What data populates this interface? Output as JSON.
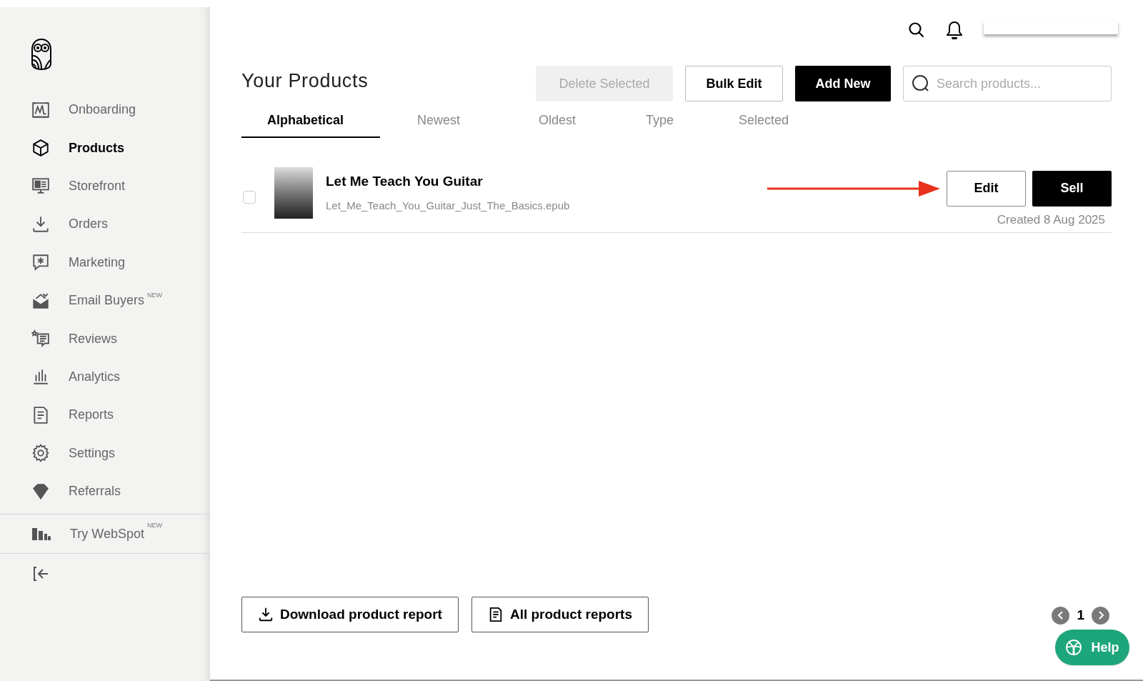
{
  "sidebar": {
    "items": [
      {
        "label": "Onboarding",
        "selected": false
      },
      {
        "label": "Products",
        "selected": true
      },
      {
        "label": "Storefront",
        "selected": false
      },
      {
        "label": "Orders",
        "selected": false
      },
      {
        "label": "Marketing",
        "selected": false
      },
      {
        "label": "Email Buyers",
        "badge": "NEW",
        "selected": false
      },
      {
        "label": "Reviews",
        "selected": false
      },
      {
        "label": "Analytics",
        "selected": false
      },
      {
        "label": "Reports",
        "selected": false
      },
      {
        "label": "Settings",
        "selected": false
      },
      {
        "label": "Referrals",
        "selected": false
      }
    ],
    "extra": {
      "label": "Try WebSpot",
      "badge": "NEW"
    }
  },
  "page": {
    "title": "Your Products",
    "actions": [
      {
        "label": "Delete Selected",
        "kind": "disabled"
      },
      {
        "label": "Bulk Edit",
        "kind": "outline"
      },
      {
        "label": "Add New",
        "kind": "primary"
      }
    ],
    "search": {
      "placeholder": "Search products..."
    },
    "tabs": [
      {
        "label": "Alphabetical",
        "selected": true
      },
      {
        "label": "Newest",
        "selected": false
      },
      {
        "label": "Oldest",
        "selected": false
      },
      {
        "label": "Type",
        "selected": false
      },
      {
        "label": "Selected",
        "selected": false
      }
    ],
    "products": [
      {
        "title": "Let Me Teach You Guitar",
        "file": "Let_Me_Teach_You_Guitar_Just_The_Basics.epub",
        "created": "Created 8 Aug 2025",
        "checked": false,
        "edit": "Edit",
        "sell": "Sell"
      }
    ],
    "footer_buttons": [
      {
        "label": "Download product report"
      },
      {
        "label": "All product reports"
      }
    ],
    "pagination": {
      "page": "1"
    },
    "help": "Help"
  }
}
